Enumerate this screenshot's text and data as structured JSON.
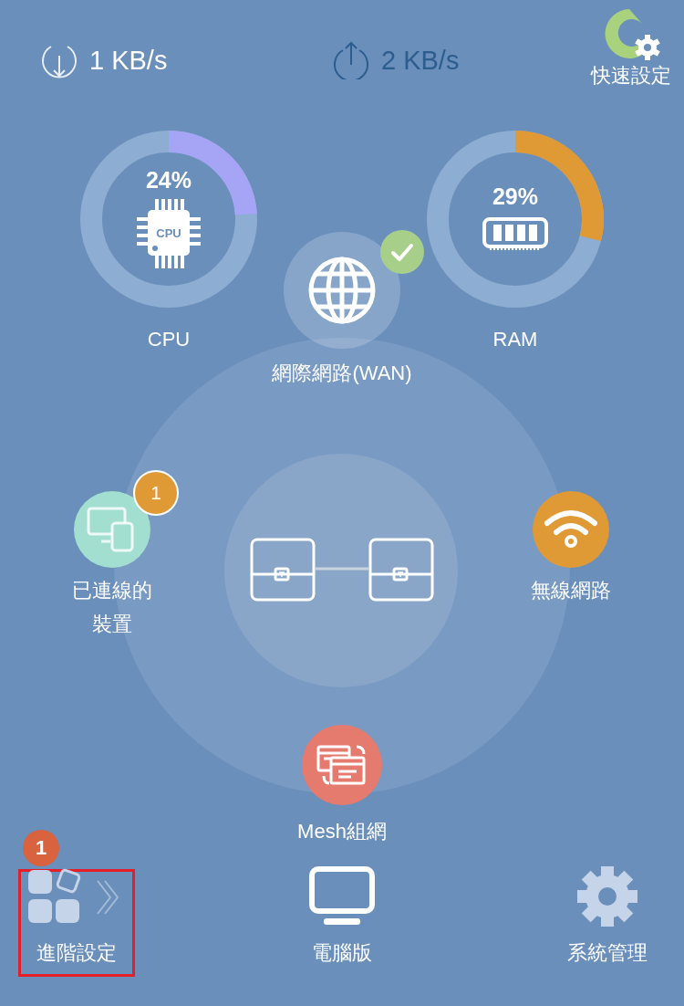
{
  "top_bar": {
    "download": "1 KB/s",
    "upload": "2 KB/s",
    "quick_setup": "快速設定"
  },
  "gauges": [
    {
      "kind": "cpu",
      "reading": "24%",
      "color": "#a5a4f5",
      "chip_text": "CPU",
      "label": "CPU"
    },
    {
      "kind": "ram",
      "reading": "29%",
      "color": "#e09a35",
      "label": "RAM"
    }
  ],
  "nodes": [
    {
      "kind": "wan",
      "label": "網際網路(WAN)",
      "connected": true
    },
    {
      "kind": "devices",
      "label": "已連線的裝置",
      "badge": "1"
    },
    {
      "kind": "wifi",
      "label": "無線網路"
    },
    {
      "kind": "mesh",
      "label": "Mesh組網"
    }
  ],
  "bottom_nav": [
    {
      "kind": "advanced",
      "label": "進階設定",
      "highlighted": true,
      "callout": "1"
    },
    {
      "kind": "desktop",
      "label": "電腦版",
      "highlighted": false
    },
    {
      "kind": "system",
      "label": "系統管理",
      "highlighted": false
    }
  ]
}
